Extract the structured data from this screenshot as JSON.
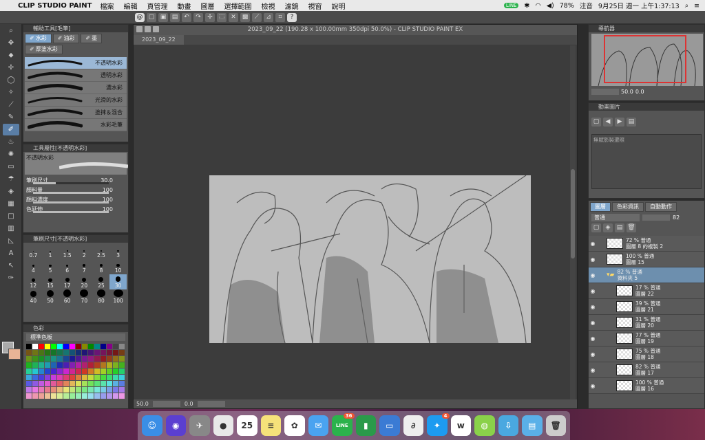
{
  "menubar": {
    "app": "CLIP STUDIO PAINT",
    "items": [
      "檔案",
      "編輯",
      "頁管理",
      "動畫",
      "圖層",
      "選擇範圍",
      "檢視",
      "濾鏡",
      "視窗",
      "說明"
    ],
    "battery": "78%",
    "notes": "注音",
    "clock": "9月25日 週一 上午1:37:13"
  },
  "canvas": {
    "title": "2023_09_22 (190.28 x 100.00mm 350dpi 50.0%) - CLIP STUDIO PAINT EX",
    "tab": "2023_09_22",
    "zoom": "50.0",
    "coord": "0.0"
  },
  "subtool": {
    "title": "輔助工具[毛筆]",
    "tabs": [
      "水彩",
      "油彩",
      "墨",
      "厚塗水彩"
    ],
    "brushes": [
      "不透明水彩",
      "透明水彩",
      "濃水彩",
      "光滑的水彩",
      "塗抹＆混合",
      "水彩毛筆"
    ]
  },
  "toolprop": {
    "title": "工具屬性[不透明水彩]",
    "name": "不透明水彩",
    "rows": [
      {
        "label": "筆刷尺寸",
        "value": "30.0",
        "fill": 0.3
      },
      {
        "label": "顏料量",
        "value": "100",
        "fill": 1
      },
      {
        "label": "顏料濃度",
        "value": "100",
        "fill": 1
      },
      {
        "label": "色延伸",
        "value": "100",
        "fill": 1
      }
    ]
  },
  "brushsize": {
    "title": "筆刷尺寸[不透明水彩]",
    "sizes": [
      "0.7",
      "1",
      "1.5",
      "2",
      "2.5",
      "3",
      "4",
      "5",
      "6",
      "7",
      "8",
      "10",
      "12",
      "15",
      "17",
      "20",
      "25",
      "30",
      "40",
      "50",
      "60",
      "70",
      "80",
      "100"
    ]
  },
  "colorset": {
    "title": "色彩",
    "set_name": "標準色板"
  },
  "navigator": {
    "title": "導航器",
    "zoom": "50.0",
    "angle": "0.0"
  },
  "anim": {
    "title": "動畫圖片",
    "list": "無賦影製遷照"
  },
  "layers": {
    "title": "圖層",
    "tabs": [
      "圖層",
      "色彩資訊",
      "自動動作"
    ],
    "mode": "普通",
    "opacity": "82",
    "rows": [
      {
        "l1": "72 % 普通",
        "l2": "圖層 8 的複製 2",
        "sub": false,
        "on": false
      },
      {
        "l1": "100 % 普通",
        "l2": "圖層 15",
        "sub": false,
        "on": false
      },
      {
        "l1": "82 % 普通",
        "l2": "資料夾 5",
        "sub": false,
        "on": true
      },
      {
        "l1": "17 % 普通",
        "l2": "圖層 22",
        "sub": true,
        "on": false
      },
      {
        "l1": "39 % 普通",
        "l2": "圖層 21",
        "sub": true,
        "on": false
      },
      {
        "l1": "31 % 普通",
        "l2": "圖層 20",
        "sub": true,
        "on": false
      },
      {
        "l1": "77 % 普通",
        "l2": "圖層 19",
        "sub": true,
        "on": false
      },
      {
        "l1": "75 % 普通",
        "l2": "圖層 18",
        "sub": true,
        "on": false
      },
      {
        "l1": "82 % 普通",
        "l2": "圖層 17",
        "sub": true,
        "on": false
      },
      {
        "l1": "100 % 普通",
        "l2": "圖層 16",
        "sub": true,
        "on": false
      }
    ]
  },
  "dock": {
    "apps": [
      {
        "name": "finder",
        "color": "#3a8ee6",
        "glyph": "☺"
      },
      {
        "name": "siri",
        "color": "#5b3fd0",
        "glyph": "◉"
      },
      {
        "name": "launchpad",
        "color": "#888",
        "glyph": "✈"
      },
      {
        "name": "chrome",
        "color": "#e8e8e8",
        "glyph": "●"
      },
      {
        "name": "calendar",
        "color": "#fff",
        "glyph": "25"
      },
      {
        "name": "notes",
        "color": "#f6e27a",
        "glyph": "≡"
      },
      {
        "name": "photos",
        "color": "#fff",
        "glyph": "✿"
      },
      {
        "name": "mail",
        "color": "#4aa3f0",
        "glyph": "✉"
      },
      {
        "name": "line",
        "color": "#2bb24c",
        "glyph": "LINE",
        "badge": "36"
      },
      {
        "name": "numbers",
        "color": "#2a9a4a",
        "glyph": "▮"
      },
      {
        "name": "keynote",
        "color": "#3b7bd4",
        "glyph": "▭"
      },
      {
        "name": "clipstudio",
        "color": "#eee",
        "glyph": "∂"
      },
      {
        "name": "twitter",
        "color": "#1d9bf0",
        "glyph": "✦",
        "badge": "4"
      },
      {
        "name": "webtoon",
        "color": "#fff",
        "glyph": "w"
      },
      {
        "name": "lime",
        "color": "#8ad14a",
        "glyph": "◍"
      },
      {
        "name": "downloads",
        "color": "#4aa8e0",
        "glyph": "⇩"
      },
      {
        "name": "folder",
        "color": "#5ab0e8",
        "glyph": "▤"
      },
      {
        "name": "trash",
        "color": "#ccc",
        "glyph": "🗑"
      }
    ]
  }
}
